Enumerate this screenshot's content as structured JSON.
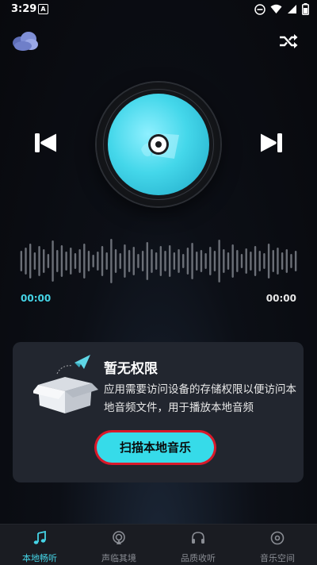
{
  "status_bar": {
    "time": "3:29",
    "notification_icon": "A"
  },
  "top_bar": {
    "left_icon": "cloud-icon",
    "right_icon": "shuffle-icon"
  },
  "player": {
    "prev_icon": "skip-previous-icon",
    "next_icon": "skip-next-icon",
    "current_time": "00:00",
    "total_time": "00:00",
    "accent": "#45d4e6"
  },
  "permission_card": {
    "title": "暂无权限",
    "description": "应用需要访问设备的存储权限以便访问本地音频文件，用于播放本地音频",
    "button_label": "扫描本地音乐"
  },
  "tabs": [
    {
      "label": "本地畅听",
      "icon": "music-note-icon",
      "active": true
    },
    {
      "label": "声临其境",
      "icon": "podcast-icon",
      "active": false
    },
    {
      "label": "品质收听",
      "icon": "headphones-icon",
      "active": false
    },
    {
      "label": "音乐空间",
      "icon": "disc-icon",
      "active": false
    }
  ]
}
